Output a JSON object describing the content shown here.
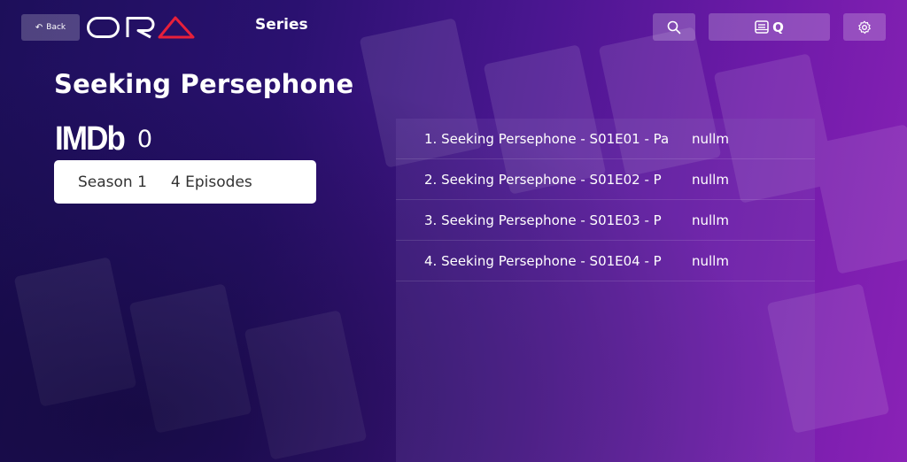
{
  "header": {
    "back_label": "Back",
    "back_icon": "undo-arrow-icon",
    "logo_text": "ORA",
    "title": "Series",
    "search_icon": "search-icon",
    "queue_label": "Q",
    "queue_icon": "list-box-icon",
    "settings_icon": "gear-icon"
  },
  "series": {
    "title": "Seeking Persephone",
    "imdb_label": "IMDb",
    "imdb_rating": "0"
  },
  "season": {
    "name": "Season 1",
    "episode_count": "4 Episodes"
  },
  "episodes": [
    {
      "title": "1. Seeking Persephone - S01E01 - Pa",
      "extra": "nullm"
    },
    {
      "title": "2. Seeking Persephone - S01E02 - P",
      "extra": "nullm"
    },
    {
      "title": "3. Seeking Persephone - S01E03 - P",
      "extra": "nullm"
    },
    {
      "title": "4. Seeking Persephone - S01E04 - P",
      "extra": "nullm"
    }
  ],
  "colors": {
    "logo_accent": "#e8203a",
    "background_left": "#1d0f5a",
    "background_right": "#8a22b6"
  }
}
